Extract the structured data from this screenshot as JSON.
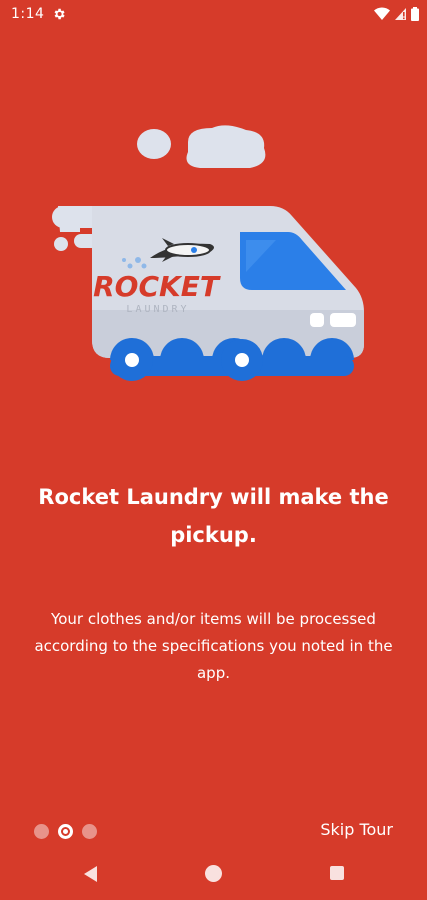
{
  "status_bar": {
    "time": "1:14",
    "icons": [
      "settings-icon",
      "wifi-icon",
      "no-sim-icon",
      "battery-icon"
    ]
  },
  "illustration": {
    "brand_name": "ROCKET",
    "brand_sub": "LAUNDRY"
  },
  "onboarding": {
    "headline": "Rocket Laundry will make the pickup.",
    "description": "Your clothes and/or items will be processed according to the specifications you noted in the app.",
    "page_indicator": {
      "total": 3,
      "current": 2
    },
    "skip_label": "Skip Tour"
  },
  "colors": {
    "background": "#D63B2A",
    "van_body": "#D8DCE6",
    "van_window": "#2B7FE8",
    "wheel": "#1F6FD8"
  }
}
